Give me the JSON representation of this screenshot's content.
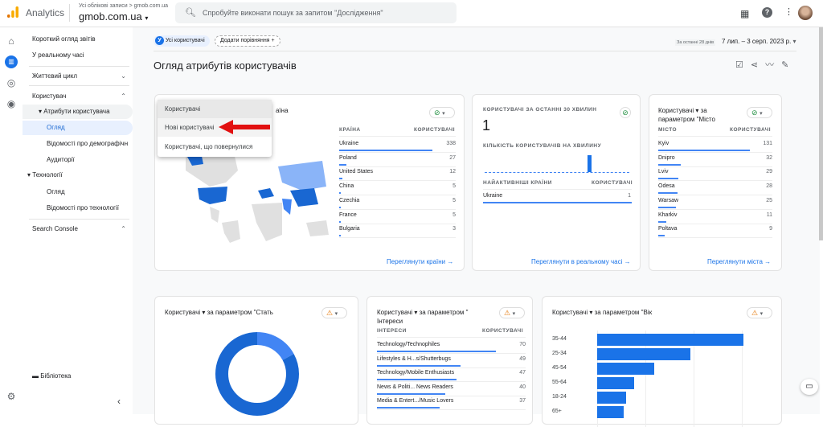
{
  "header": {
    "brand": "Analytics",
    "breadcrumb": "Усі облікові записи > gmob.com.ua",
    "property": "gmob.com.ua",
    "search_placeholder": "Спробуйте виконати пошук за запитом \"Дослідження\""
  },
  "sidebar": {
    "items": [
      {
        "label": "Короткий огляд звітів"
      },
      {
        "label": "У реальному часі"
      },
      {
        "label": "Життєвий цикл"
      },
      {
        "label": "Користувач"
      },
      {
        "label": "Атрибути користувача"
      },
      {
        "label": "Огляд"
      },
      {
        "label": "Відомості про демографічн"
      },
      {
        "label": "Аудиторії"
      },
      {
        "label": "Технології"
      },
      {
        "label": "Огляд"
      },
      {
        "label": "Відомості про технології"
      },
      {
        "label": "Search Console"
      }
    ],
    "library": "Бібліотека"
  },
  "toolbar": {
    "segment_badge": "У",
    "segment": "Усі користувачі",
    "add_comparison": "Додати порівняння",
    "date_hint": "За останні 28 днів",
    "date_range": "7 лип. – 3 серп. 2023 р."
  },
  "page_title": "Огляд атрибутів користувачів",
  "metric_menu": {
    "items": [
      "Користувачі",
      "Нові користувачі",
      "Користувачі, що повернулися"
    ]
  },
  "country_card": {
    "title_tail": "аїна",
    "col1": "КРАЇНА",
    "col2": "КОРИСТУВАЧІ",
    "rows": [
      {
        "name": "Ukraine",
        "value": 338
      },
      {
        "name": "Poland",
        "value": 27
      },
      {
        "name": "United States",
        "value": 12
      },
      {
        "name": "China",
        "value": 5
      },
      {
        "name": "Czechia",
        "value": 5
      },
      {
        "name": "France",
        "value": 5
      },
      {
        "name": "Bulgaria",
        "value": 3
      }
    ],
    "link": "Переглянути країни"
  },
  "realtime_card": {
    "title": "КОРИСТУВАЧІ ЗА ОСТАННІ 30 ХВИЛИН",
    "value": "1",
    "subtitle": "КІЛЬКІСТЬ КОРИСТУВАЧІВ НА ХВИЛИНУ",
    "col1": "НАЙАКТИВНІШІ КРАЇНИ",
    "col2": "КОРИСТУВАЧІ",
    "rows": [
      {
        "name": "Ukraine",
        "value": 1
      }
    ],
    "link": "Переглянути в реальному часі"
  },
  "city_card": {
    "title": "Користувачі ▾ за параметром \"Місто",
    "col1": "МІСТО",
    "col2": "КОРИСТУВАЧІ",
    "rows": [
      {
        "name": "Kyiv",
        "value": 131
      },
      {
        "name": "Dnipro",
        "value": 32
      },
      {
        "name": "Lviv",
        "value": 29
      },
      {
        "name": "Odesa",
        "value": 28
      },
      {
        "name": "Warsaw",
        "value": 25
      },
      {
        "name": "Kharkiv",
        "value": 11
      },
      {
        "name": "Poltava",
        "value": 9
      }
    ],
    "link": "Переглянути міста"
  },
  "gender_card": {
    "title": "Користувачі ▾ за параметром \"Стать",
    "donut_shares": [
      0.17,
      0.83
    ],
    "colors": [
      "#4285f4",
      "#1967d2"
    ]
  },
  "interests_card": {
    "title": "Користувачі ▾ за параметром \" Інтереси",
    "col1": "ІНТЕРЕСИ",
    "col2": "КОРИСТУВАЧІ",
    "rows": [
      {
        "name": "Technology/Technophiles",
        "value": 70
      },
      {
        "name": "Lifestyles & H...s/Shutterbugs",
        "value": 49
      },
      {
        "name": "Technology/Mobile Enthusiasts",
        "value": 47
      },
      {
        "name": "News & Politi... News Readers",
        "value": 40
      },
      {
        "name": "Media & Entert.../Music Lovers",
        "value": 37
      }
    ]
  },
  "age_card": {
    "title": "Користувачі ▾ за параметром \"Вік",
    "categories": [
      "35-44",
      "25-34",
      "45-54",
      "55-64",
      "18-24",
      "65+"
    ],
    "values": [
      100,
      64,
      39,
      25,
      20,
      18
    ]
  },
  "colors": {
    "accent": "#1a73e8",
    "bar": "#1a73e8",
    "warning": "#e37400"
  }
}
